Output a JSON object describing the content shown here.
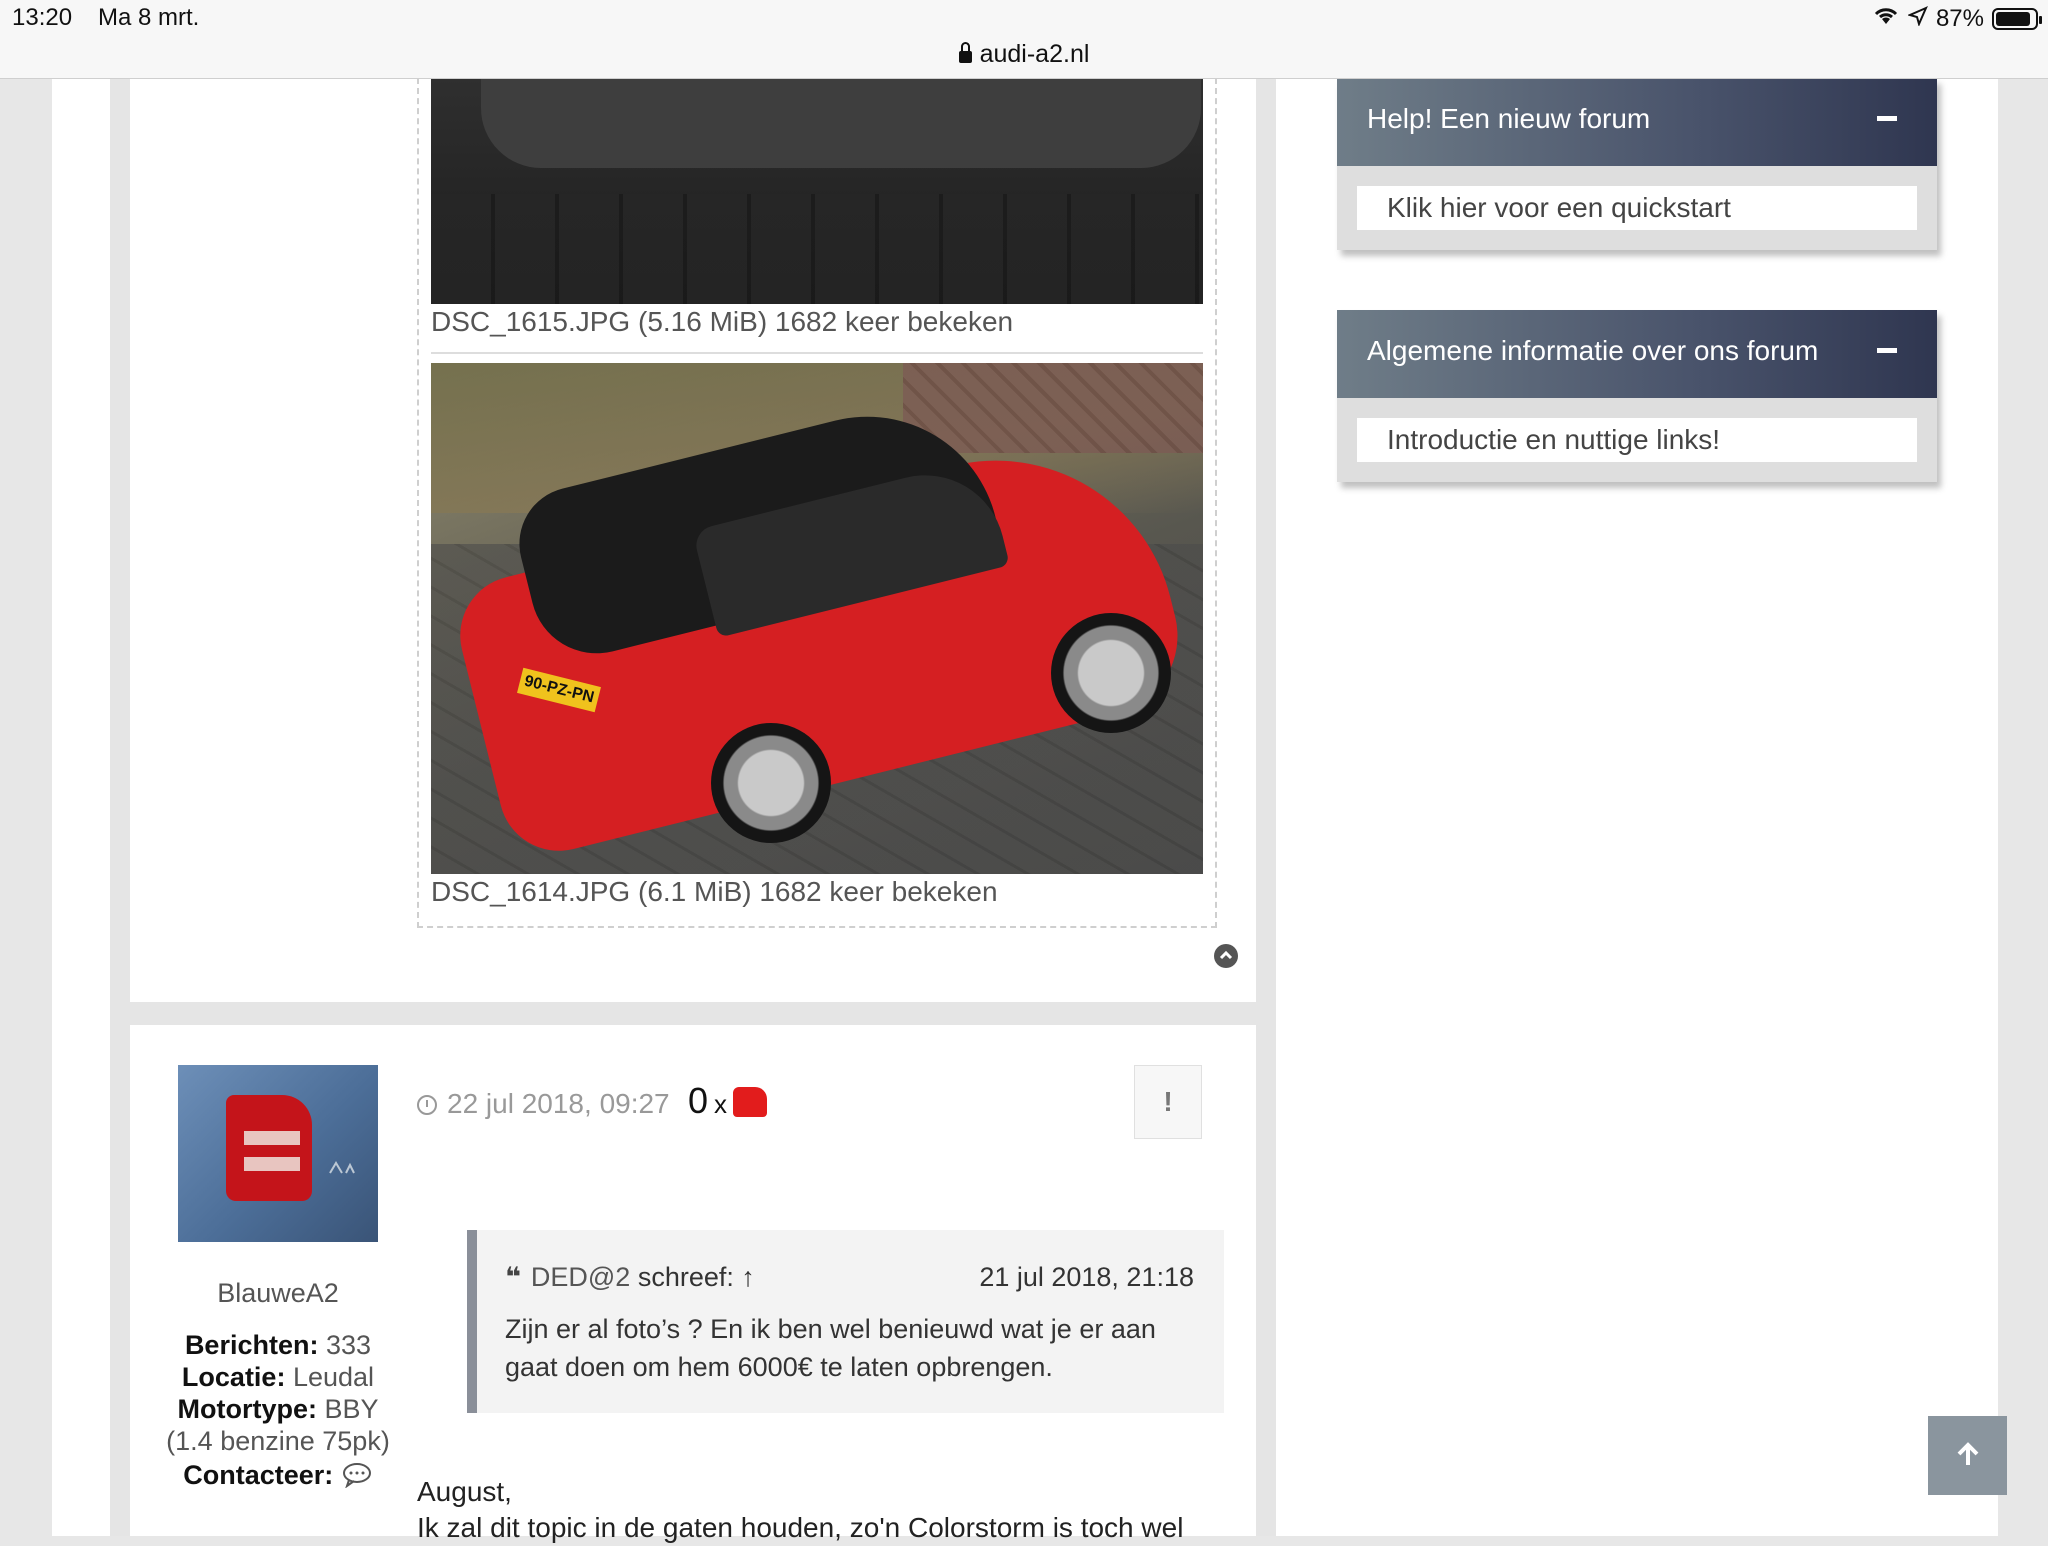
{
  "status": {
    "time": "13:20",
    "date": "Ma 8 mrt.",
    "battery": "87%",
    "url": "audi-a2.nl"
  },
  "post1": {
    "attachments": [
      {
        "caption": "DSC_1615.JPG (5.16 MiB) 1682 keer bekeken"
      },
      {
        "caption": "DSC_1614.JPG (6.1 MiB) 1682 keer bekeken",
        "plate": "90-PZ-PN"
      }
    ]
  },
  "sidebar": {
    "panels": [
      {
        "title": "Help! Een nieuw forum",
        "link": "Klik hier voor een quickstart"
      },
      {
        "title": "Algemene informatie over ons forum",
        "link": "Introductie en nuttige links!"
      }
    ]
  },
  "post2": {
    "username": "BlauweA2",
    "info": {
      "berichten_label": "Berichten:",
      "berichten": "333",
      "locatie_label": "Locatie:",
      "locatie": "Leudal",
      "motortype_label": "Motortype:",
      "motortype": "BBY",
      "motortype_detail": "(1.4 benzine 75pk)",
      "contact_label": "Contacteer:"
    },
    "timestamp": "22 jul 2018, 09:27",
    "likes_count": "0",
    "likes_x": "x",
    "report_label": "!",
    "quote": {
      "author": "DED@2",
      "wrote": "schreef:",
      "arrow": "↑",
      "date": "21 jul 2018, 21:18",
      "text": "Zijn er al foto’s ? En ik ben wel benieuwd wat je er aan gaat doen om hem 6000€ te laten opbrengen."
    },
    "body_line1": "August,",
    "body_line2": "Ik zal dit topic in de gaten houden, zo'n Colorstorm is toch wel"
  }
}
